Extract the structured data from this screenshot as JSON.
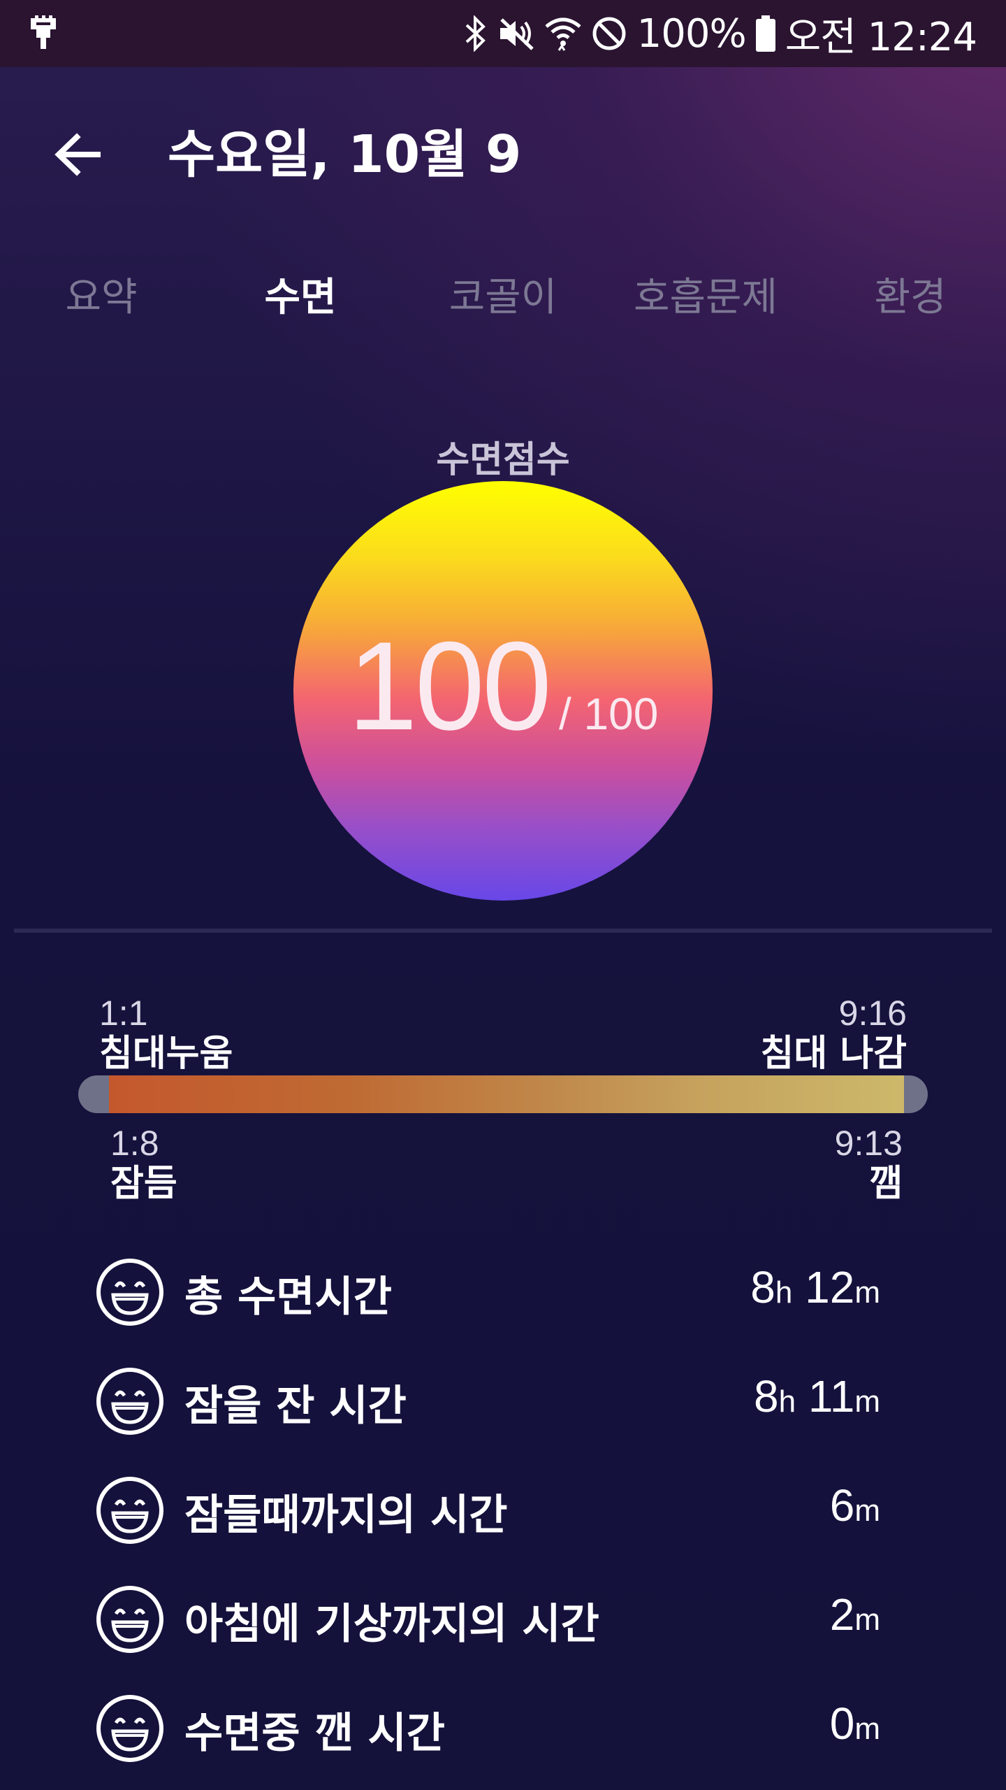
{
  "status_bar": {
    "battery": "100%",
    "time": "오전 12:24",
    "icons": [
      "usb-icon",
      "bluetooth-icon",
      "mute-icon",
      "wifi-icon",
      "do-not-disturb-icon",
      "battery-icon"
    ]
  },
  "header": {
    "title": "수요일, 10월 9",
    "back_icon": "arrow-left-icon"
  },
  "tabs": [
    {
      "label": "요약",
      "active": false
    },
    {
      "label": "수면",
      "active": true
    },
    {
      "label": "코골이",
      "active": false
    },
    {
      "label": "호흡문제",
      "active": false
    },
    {
      "label": "환경",
      "active": false
    }
  ],
  "score": {
    "label": "수면점수",
    "value": "100",
    "max": "/ 100"
  },
  "timeline": {
    "bed_in_time": "1:1",
    "bed_in_label": "침대누움",
    "bed_out_time": "9:16",
    "bed_out_label": "침대 나감",
    "asleep_time": "1:8",
    "asleep_label": "잠듬",
    "awake_time": "9:13",
    "awake_label": "깸"
  },
  "stats": [
    {
      "label": "총 수면시간",
      "value_h": "8",
      "unit_h": "h",
      "value_m": "12",
      "unit_m": "m",
      "icon": "smiley-icon"
    },
    {
      "label": "잠을 잔 시간",
      "value_h": "8",
      "unit_h": "h",
      "value_m": "11",
      "unit_m": "m",
      "icon": "smiley-icon"
    },
    {
      "label": "잠들때까지의 시간",
      "value_h": "",
      "unit_h": "",
      "value_m": "6",
      "unit_m": "m",
      "icon": "smiley-icon"
    },
    {
      "label": "아침에 기상까지의 시간",
      "value_h": "",
      "unit_h": "",
      "value_m": "2",
      "unit_m": "m",
      "icon": "smiley-icon"
    },
    {
      "label": "수면중 깬 시간",
      "value_h": "",
      "unit_h": "",
      "value_m": "0",
      "unit_m": "m",
      "icon": "smiley-icon"
    }
  ]
}
